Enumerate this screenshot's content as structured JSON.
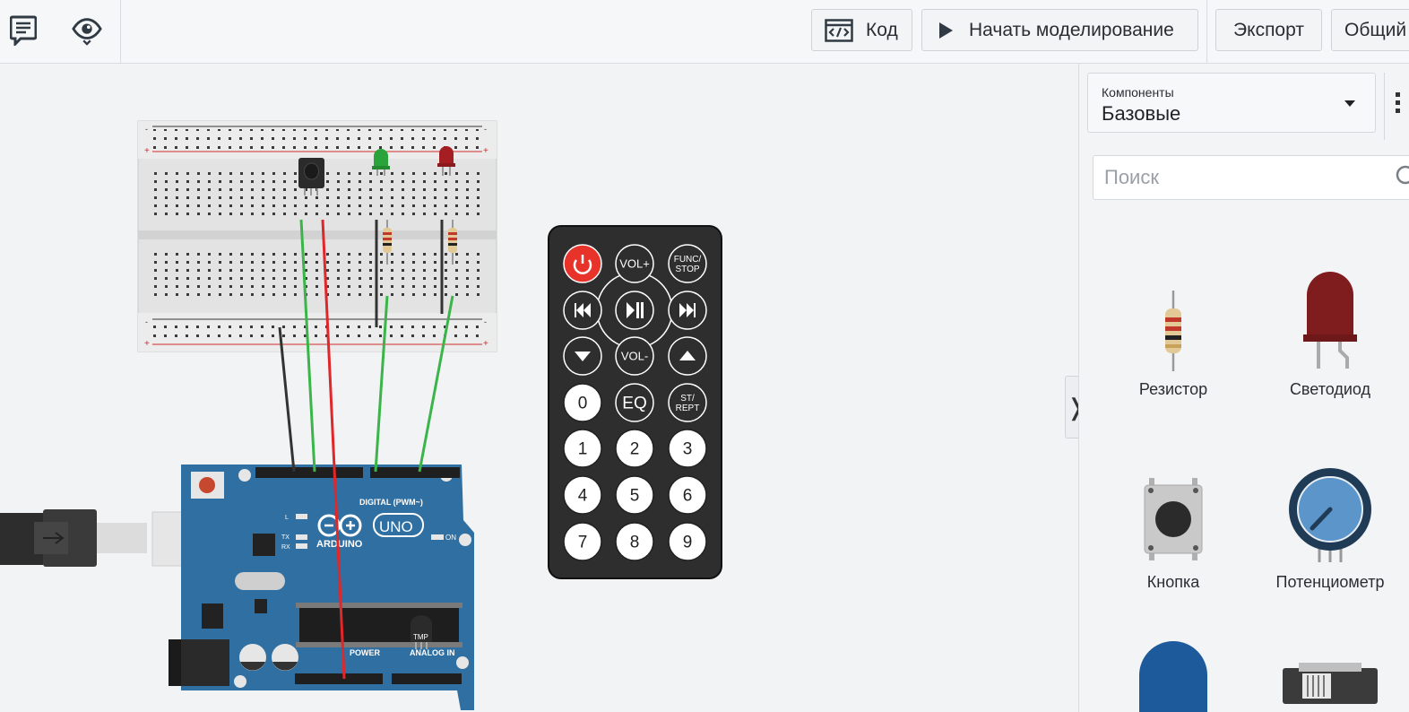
{
  "toolbar": {
    "code_label": "Код",
    "simulate_label": "Начать моделирование",
    "export_label": "Экспорт",
    "share_label": "Общий"
  },
  "remote": {
    "buttons": [
      "VOL+",
      "FUNC/\nSTOP",
      "VOL-",
      "0",
      "EQ",
      "ST/\nREPT",
      "1",
      "2",
      "3",
      "4",
      "5",
      "6",
      "7",
      "8",
      "9"
    ]
  },
  "arduino": {
    "brand": "ARDUINO",
    "model": "UNO",
    "digital_label": "DIGITAL (PWM~)",
    "power_label": "POWER",
    "analog_label": "ANALOG IN",
    "on_label": "ON",
    "l_label": "L",
    "tx_label": "TX",
    "rx_label": "RX",
    "chip_label": "TMP"
  },
  "panel": {
    "select_label": "Компоненты",
    "select_value": "Базовые",
    "search_placeholder": "Поиск",
    "components": [
      "Резистор",
      "Светодиод",
      "Кнопка",
      "Потенциометр"
    ]
  },
  "colors": {
    "arduino_board": "#2f6fa1",
    "wire_green": "#3bb54a",
    "wire_red": "#e0272a",
    "wire_black": "#333333",
    "led_green": "#2aa43a",
    "led_red": "#a51e22",
    "power_button": "#e8332a"
  }
}
